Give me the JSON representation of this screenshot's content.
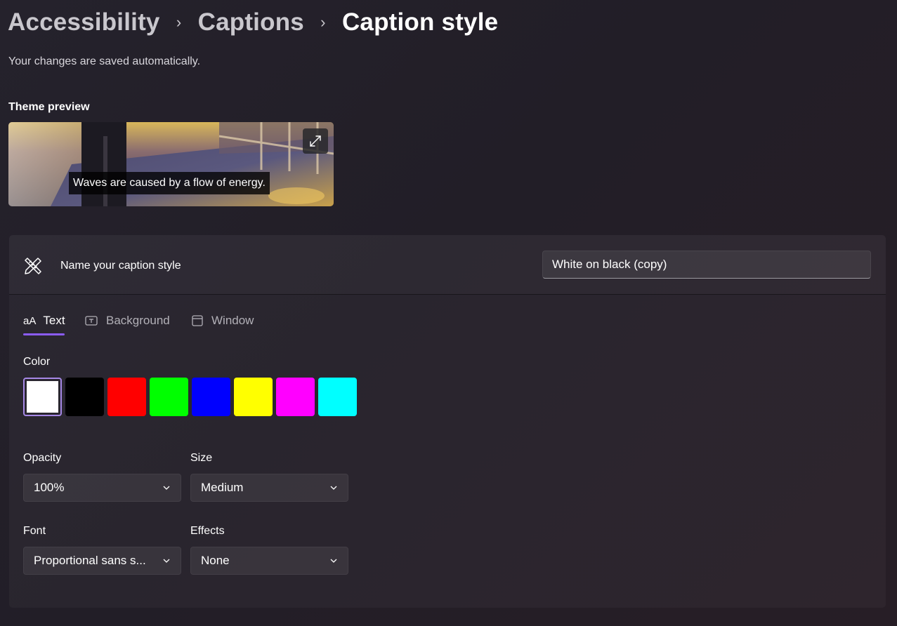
{
  "breadcrumb": {
    "items": [
      "Accessibility",
      "Captions"
    ],
    "separator": "›",
    "current": "Caption style"
  },
  "subtitle": "Your changes are saved automatically.",
  "preview": {
    "label": "Theme preview",
    "caption_text": "Waves are caused by a flow of energy.",
    "expand_icon": "expand-icon"
  },
  "name_row": {
    "icon": "pen-ruler-icon",
    "label": "Name your caption style",
    "value": "White on black (copy)"
  },
  "tabs": [
    {
      "label": "Text",
      "glyph": "aA",
      "selected": true
    },
    {
      "label": "Background",
      "icon": "background-icon",
      "selected": false
    },
    {
      "label": "Window",
      "icon": "window-icon",
      "selected": false
    }
  ],
  "color": {
    "label": "Color",
    "selected_index": 0,
    "swatches": [
      {
        "name": "White",
        "hex": "#ffffff"
      },
      {
        "name": "Black",
        "hex": "#000000"
      },
      {
        "name": "Red",
        "hex": "#ff0000"
      },
      {
        "name": "Green",
        "hex": "#00ff00"
      },
      {
        "name": "Blue",
        "hex": "#0000ff"
      },
      {
        "name": "Yellow",
        "hex": "#ffff00"
      },
      {
        "name": "Magenta",
        "hex": "#ff00ff"
      },
      {
        "name": "Cyan",
        "hex": "#00ffff"
      }
    ]
  },
  "fields": {
    "opacity": {
      "label": "Opacity",
      "value": "100%"
    },
    "size": {
      "label": "Size",
      "value": "Medium"
    },
    "font": {
      "label": "Font",
      "value": "Proportional sans s..."
    },
    "effects": {
      "label": "Effects",
      "value": "None"
    }
  },
  "colors": {
    "accent": "#8b5cf6",
    "selected_swatch_border": "#a688e6"
  }
}
